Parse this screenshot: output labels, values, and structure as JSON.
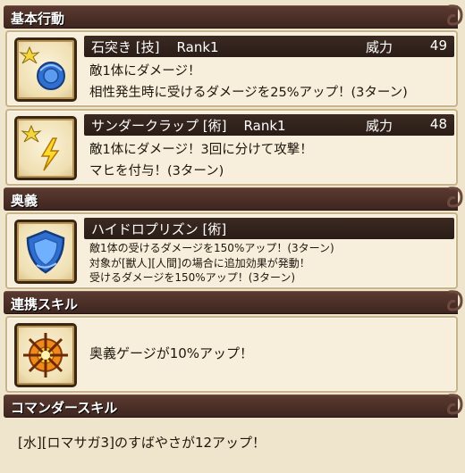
{
  "sections": {
    "basic": "基本行動",
    "ougi": "奥義",
    "renkei": "連携スキル",
    "commander": "コマンダースキル"
  },
  "skills": [
    {
      "name": "石突き [技]    Rank1",
      "power_label": "威力",
      "power": "49",
      "icon": "thrust-ball-icon",
      "lines": [
        "敵1体にダメージ！",
        "相性発生時に受けるダメージを25%アップ！(3ターン)"
      ]
    },
    {
      "name": "サンダークラップ [術]    Rank1",
      "power_label": "威力",
      "power": "48",
      "icon": "lightning-icon",
      "lines": [
        "敵1体にダメージ！3回に分けて攻撃！",
        "マヒを付与！(3ターン)"
      ]
    }
  ],
  "ougi": {
    "name": "ハイドロプリズン [術]",
    "icon": "water-shield-icon",
    "lines": [
      "敵1体の受けるダメージを150%アップ！(3ターン)",
      "対象が[獣人][人間]の場合に追加効果が発動！",
      "受けるダメージを150%アップ！(3ターン)"
    ]
  },
  "renkei": {
    "icon": "flame-compass-icon",
    "text": "奥義ゲージが10%アップ！"
  },
  "commander": {
    "text": "[水][ロマサガ3]のすばやさが12アップ！"
  },
  "colors": {
    "header": "#4a2f28",
    "namebar": "#2f211a",
    "card_bg": "#f7efdc",
    "page_bg": "#efe4cc"
  }
}
